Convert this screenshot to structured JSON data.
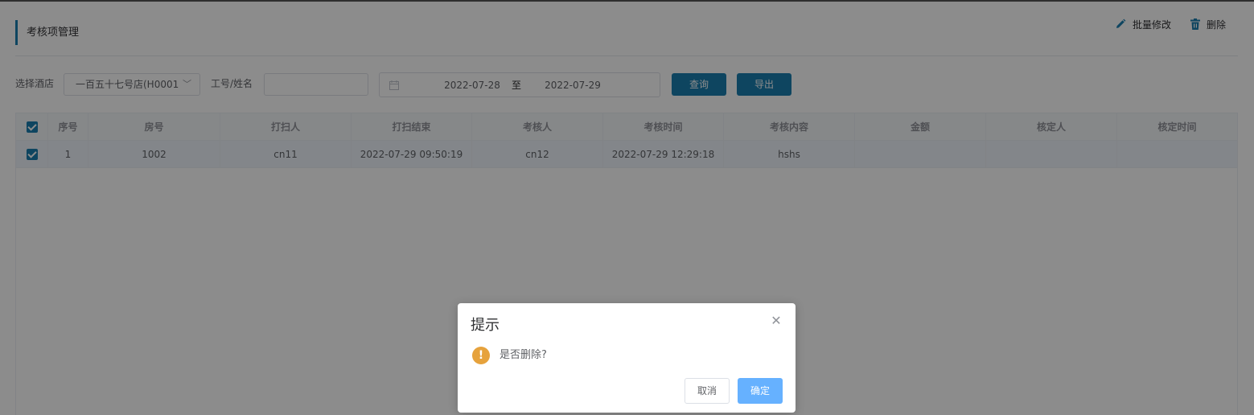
{
  "page": {
    "title": "考核项管理"
  },
  "toolbar": {
    "batch_edit_label": "批量修改",
    "delete_label": "删除",
    "accent_color": "#1a7fb0"
  },
  "filters": {
    "hotel_label": "选择酒店",
    "hotel_value": "一百五十七号店(H0001",
    "employee_label": "工号/姓名",
    "employee_value": "",
    "date_start": "2022-07-28",
    "date_separator": "至",
    "date_end": "2022-07-29",
    "query_label": "查询",
    "export_label": "导出"
  },
  "table": {
    "columns": [
      "序号",
      "房号",
      "打扫人",
      "打扫结束",
      "考核人",
      "考核时间",
      "考核内容",
      "金额",
      "核定人",
      "核定时间"
    ],
    "rows": [
      {
        "checked": true,
        "cells": [
          "1",
          "1002",
          "cn11",
          "2022-07-29 09:50:19",
          "cn12",
          "2022-07-29 12:29:18",
          "hshs",
          "",
          "",
          ""
        ]
      }
    ],
    "all_checked": true
  },
  "dialog": {
    "title": "提示",
    "message": "是否删除?",
    "cancel_label": "取消",
    "confirm_label": "确定",
    "warning_color": "#e6a23c",
    "confirm_color": "#66b1ff"
  }
}
